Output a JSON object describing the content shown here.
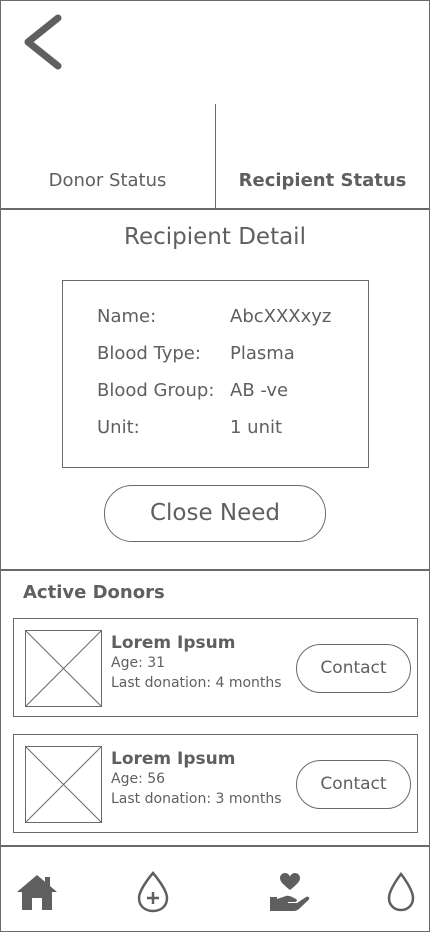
{
  "header": {
    "back_icon": "chevron-left-icon"
  },
  "tabs": [
    {
      "label": "Donor Status",
      "active": false
    },
    {
      "label": "Recipient Status",
      "active": true
    }
  ],
  "detail": {
    "title": "Recipient Detail",
    "rows": [
      {
        "key": "Name:",
        "value": "AbcXXXxyz"
      },
      {
        "key": "Blood Type:",
        "value": "Plasma"
      },
      {
        "key": "Blood Group:",
        "value": "AB -ve"
      },
      {
        "key": "Unit:",
        "value": "1 unit"
      }
    ],
    "close_label": "Close Need"
  },
  "active_donors": {
    "title": "Active Donors",
    "items": [
      {
        "name": "Lorem Ipsum",
        "age": "Age: 31",
        "last_donation": "Last donation: 4 months",
        "contact_label": "Contact"
      },
      {
        "name": "Lorem Ipsum",
        "age": "Age: 56",
        "last_donation": "Last donation: 3 months",
        "contact_label": "Contact"
      }
    ]
  },
  "bottom_nav": [
    {
      "icon": "home-icon"
    },
    {
      "icon": "add-blood-drop-icon"
    },
    {
      "icon": "heart-hand-icon"
    },
    {
      "icon": "blood-drop-icon"
    }
  ],
  "colors": {
    "line": "#6a6a6a",
    "text": "#5f5f5f",
    "background": "#ffffff"
  }
}
